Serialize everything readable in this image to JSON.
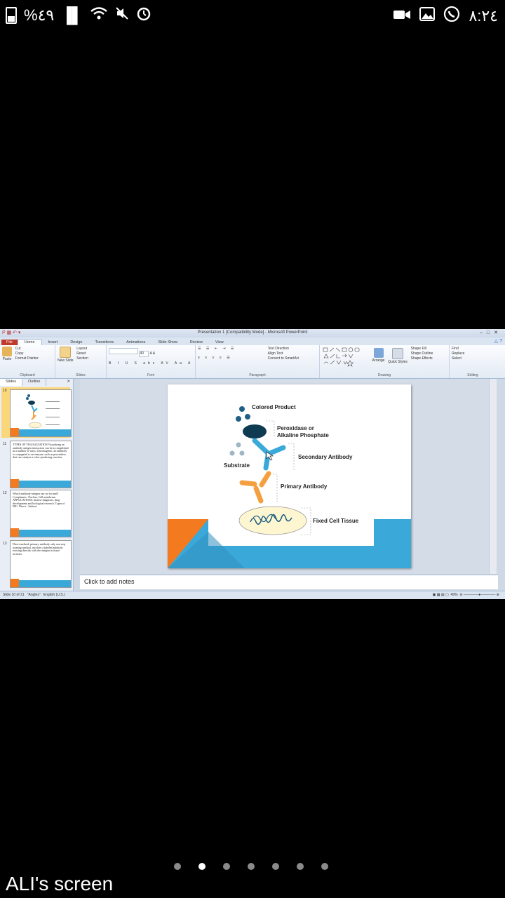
{
  "status_bar": {
    "battery": "%٤٩",
    "time": "٨:٢٤",
    "left_icons": [
      "battery-icon",
      "signal-icon",
      "wifi-icon",
      "mute-icon",
      "alarm-icon"
    ],
    "right_icons": [
      "video-icon",
      "gallery-icon",
      "whatsapp-icon"
    ]
  },
  "window": {
    "title": "Presentation 1 [Compatibility Mode] - Microsoft PowerPoint"
  },
  "ribbon": {
    "tabs": [
      "File",
      "Home",
      "Insert",
      "Design",
      "Transitions",
      "Animations",
      "Slide Show",
      "Review",
      "View"
    ],
    "active_tab": "Home",
    "clipboard": {
      "paste": "Paste",
      "cut": "Cut",
      "copy": "Copy",
      "format_painter": "Format Painter",
      "label": "Clipboard"
    },
    "slides": {
      "new_slide": "New Slide",
      "layout": "Layout",
      "reset": "Reset",
      "section": "Section",
      "label": "Slides"
    },
    "font": {
      "size": "40",
      "label": "Font"
    },
    "paragraph": {
      "text_direction": "Text Direction",
      "align_text": "Align Text",
      "convert": "Convert to SmartArt",
      "label": "Paragraph"
    },
    "drawing": {
      "arrange": "Arrange",
      "quick_styles": "Quick Styles",
      "shape_fill": "Shape Fill",
      "shape_outline": "Shape Outline",
      "shape_effects": "Shape Effects",
      "label": "Drawing"
    },
    "editing": {
      "find": "Find",
      "replace": "Replace",
      "select": "Select",
      "label": "Editing"
    }
  },
  "left_panel": {
    "tabs": [
      "Slides",
      "Outline"
    ],
    "thumbnails": [
      {
        "number": "10",
        "text": ""
      },
      {
        "number": "11",
        "text": "TYPES OF VISUALIZATION Visualizing an antibody-antigen interaction can be accomplished in a number of ways. Chromogenic: an antibody is conjugated to an enzyme, such as peroxidase, that can catalyze a color-producing reaction."
      },
      {
        "number": "12",
        "text": "Which antibody-antigen can we located? Cytoplasmic, Nuclear, Cell membrane APPLICATIONS: disease diagnosis, drug development and biological research. Types of IHC: Direct - Indirect"
      },
      {
        "number": "13",
        "text": "Direct method: primary antibody only one step staining method, involves a labeled antibody reacting directly with the antigen in tissue sections."
      }
    ]
  },
  "slide": {
    "labels": {
      "colored_product": "Colored Product",
      "enzyme_line1": "Peroxidase or",
      "enzyme_line2": "Alkaline Phosphate",
      "secondary": "Secondary Antibody",
      "substrate": "Substrate",
      "primary": "Primary Antibody",
      "tissue": "Fixed Cell Tissue"
    },
    "colors": {
      "orange": "#f47a20",
      "blue": "#3aa9d9",
      "navy": "#0e3a52",
      "dot_dark": "#1f5f85",
      "dot_light": "#9fb6c4"
    }
  },
  "notes_placeholder": "Click to add notes",
  "status_line": {
    "slide_info": "Slide 10 of 21",
    "theme": "\"Angles\"",
    "language": "English (U.S.)",
    "zoom": "49%"
  },
  "page_indicator": {
    "count": 7,
    "active": 2
  },
  "caption": "ALI's screen"
}
